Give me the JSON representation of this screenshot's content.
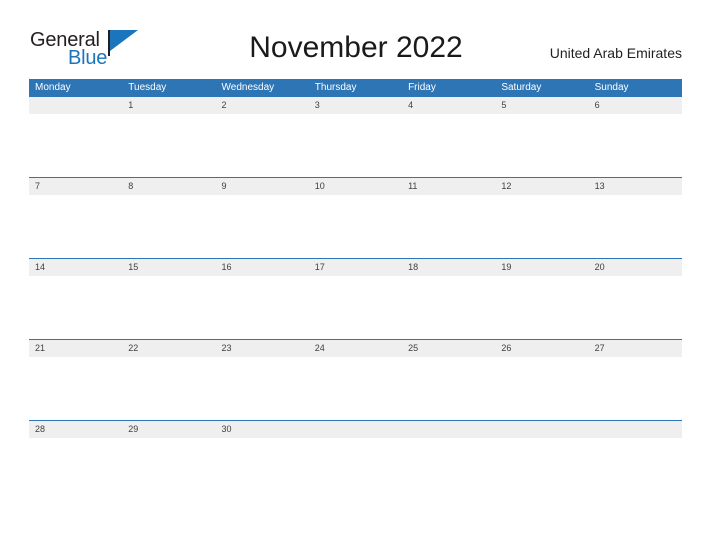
{
  "logo": {
    "word_top": "General",
    "word_bottom": "Blue",
    "flag_icon": "blue-triangle-flag-icon",
    "brand_color": "#1b75bc"
  },
  "header": {
    "title": "November 2022",
    "country": "United Arab Emirates"
  },
  "calendar": {
    "header_color": "#2e75b6",
    "band_color": "#efefef",
    "weekdays": [
      "Monday",
      "Tuesday",
      "Wednesday",
      "Thursday",
      "Friday",
      "Saturday",
      "Sunday"
    ],
    "weeks": [
      [
        "",
        "1",
        "2",
        "3",
        "4",
        "5",
        "6"
      ],
      [
        "7",
        "8",
        "9",
        "10",
        "11",
        "12",
        "13"
      ],
      [
        "14",
        "15",
        "16",
        "17",
        "18",
        "19",
        "20"
      ],
      [
        "21",
        "22",
        "23",
        "24",
        "25",
        "26",
        "27"
      ],
      [
        "28",
        "29",
        "30",
        "",
        "",
        "",
        ""
      ]
    ]
  }
}
